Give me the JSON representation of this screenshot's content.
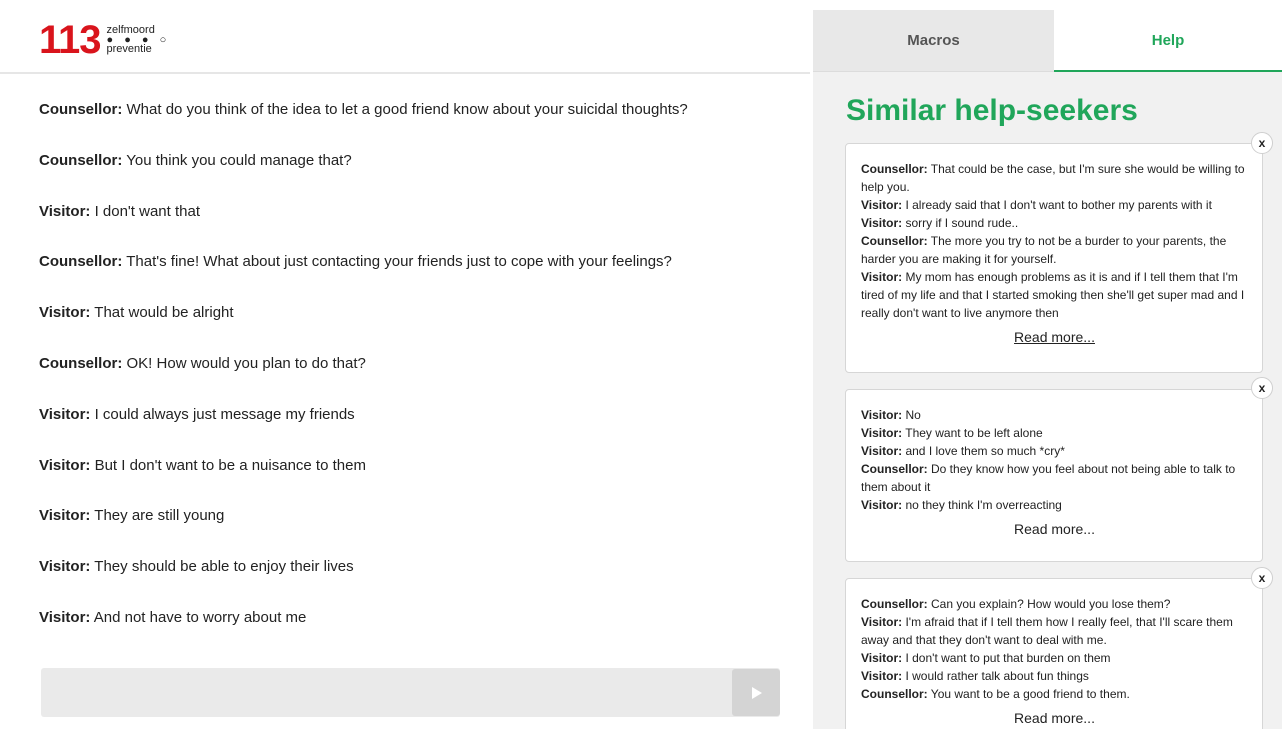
{
  "logo": {
    "number": "113",
    "line1": "zelfmoord",
    "dots": "● ● ● ○",
    "line2": "preventie"
  },
  "chat": {
    "messages": [
      {
        "speaker": "Counsellor:",
        "text": " What do you think of the idea to let a good friend know about your suicidal thoughts?"
      },
      {
        "speaker": "Counsellor:",
        "text": " You think you could manage that?"
      },
      {
        "speaker": "Visitor:",
        "text": " I don't want that"
      },
      {
        "speaker": "Counsellor:",
        "text": " That's fine! What about just contacting your friends just to cope with your feelings?"
      },
      {
        "speaker": "Visitor:",
        "text": " That would be alright"
      },
      {
        "speaker": "Counsellor:",
        "text": " OK! How would you plan to do that?"
      },
      {
        "speaker": "Visitor:",
        "text": " I could always just message my friends"
      },
      {
        "speaker": "Visitor:",
        "text": " But I don't want to be a nuisance to them"
      },
      {
        "speaker": "Visitor:",
        "text": " They are still young"
      },
      {
        "speaker": "Visitor:",
        "text": " They should be able to enjoy their lives"
      },
      {
        "speaker": "Visitor:",
        "text": " And not have to worry about me"
      }
    ],
    "composer_value": "",
    "send_icon": "play-triangle-icon"
  },
  "panel": {
    "tabs": [
      {
        "label": "Macros",
        "active": false
      },
      {
        "label": "Help",
        "active": true
      }
    ],
    "title": "Similar help-seekers",
    "close_label": "x",
    "cards": [
      {
        "lines": [
          {
            "speaker": "Counsellor:",
            "text": " That could be the case, but I'm sure she would be willing to help you."
          },
          {
            "speaker": "Visitor:",
            "text": " I already said that I don't want to bother my parents with it"
          },
          {
            "speaker": "Visitor:",
            "text": " sorry if I sound rude.."
          },
          {
            "speaker": "Counsellor:",
            "text": " The more you try to not be a burder to your parents, the harder you are making it for yourself."
          },
          {
            "speaker": "Visitor:",
            "text": " My mom has enough problems as it is and if I tell them that I'm tired of my life and that I started smoking then she'll get super mad and I really don't want to live anymore then"
          }
        ],
        "read_more": "Read more..."
      },
      {
        "lines": [
          {
            "speaker": "Visitor:",
            "text": " No"
          },
          {
            "speaker": "Visitor:",
            "text": " They want to be left alone"
          },
          {
            "speaker": "Visitor:",
            "text": " and I love them so much *cry*"
          },
          {
            "speaker": "Counsellor:",
            "text": " Do they know how you feel about not being able to talk to them about it"
          },
          {
            "speaker": "Visitor:",
            "text": " no they think I'm overreacting"
          }
        ],
        "read_more": "Read more..."
      },
      {
        "lines": [
          {
            "speaker": "Counsellor:",
            "text": " Can you explain? How would you lose them?"
          },
          {
            "speaker": "Visitor:",
            "text": " I'm afraid that if I tell them how I really feel, that I'll scare them away and that they don't want to deal with me."
          },
          {
            "speaker": "Visitor:",
            "text": " I don't want to put that burden on them"
          },
          {
            "speaker": "Visitor:",
            "text": " I would rather talk about fun things"
          },
          {
            "speaker": "Counsellor:",
            "text": " You want to be a good friend to them."
          }
        ],
        "read_more": "Read more..."
      }
    ]
  },
  "colors": {
    "brand_red": "#d9141c",
    "accent_green": "#20a65a"
  }
}
